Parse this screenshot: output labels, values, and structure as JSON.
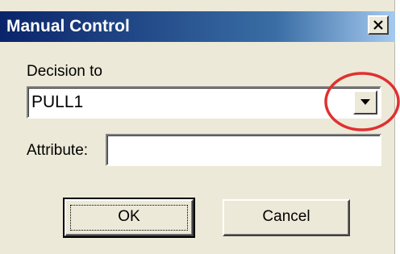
{
  "window": {
    "title": "Manual Control",
    "title_bar_color": "#0a246a",
    "close_icon": "close-icon"
  },
  "decision": {
    "label": "Decision to",
    "selected_value": "PULL1",
    "dropdown_icon": "chevron-down-icon"
  },
  "attribute": {
    "label": "Attribute:",
    "value": ""
  },
  "buttons": {
    "ok_label": "OK",
    "cancel_label": "Cancel"
  },
  "annotation": {
    "highlight_color": "#e03030"
  }
}
